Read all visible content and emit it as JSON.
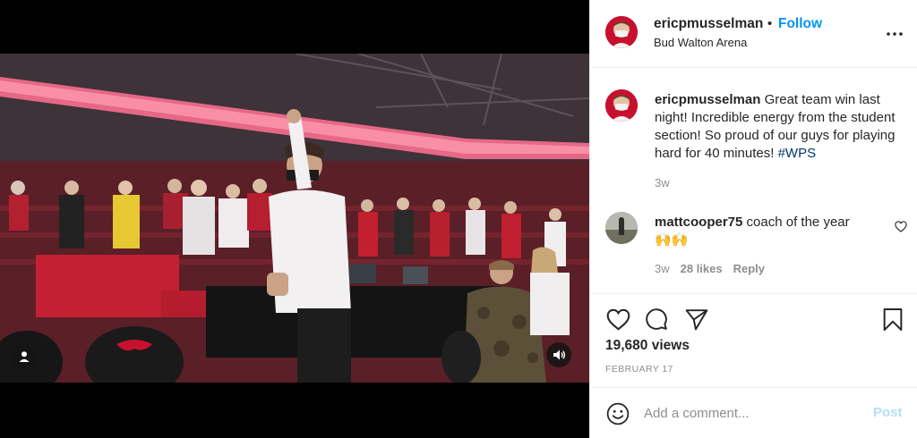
{
  "post": {
    "username": "ericpmusselman",
    "separator": "•",
    "follow_label": "Follow",
    "location": "Bud Walton Arena"
  },
  "caption": {
    "username": "ericpmusselman",
    "text": "Great team win last night! Incredible energy from the student section! So proud of our guys for playing hard for 40 minutes!",
    "hashtag": "#WPS",
    "time": "3w"
  },
  "comment": {
    "username": "mattcooper75",
    "text": "coach of the year",
    "emoji": "🙌🙌",
    "time": "3w",
    "likes": "28 likes",
    "reply_label": "Reply"
  },
  "stats": {
    "views": "19,680 views",
    "date": "FEBRUARY 17"
  },
  "add_comment": {
    "placeholder": "Add a comment...",
    "post_label": "Post"
  },
  "colors": {
    "accent": "#0095f6",
    "post_disabled": "#b2dffc",
    "hashtag": "#00376b",
    "muted": "#8e8e8e",
    "arena_red": "#c8102e"
  },
  "icons": {
    "more": "more-options-icon",
    "like": "heart-icon",
    "comment": "comment-bubble-icon",
    "share": "paper-plane-icon",
    "save": "bookmark-icon",
    "emoji": "smiley-icon",
    "user_tag": "user-tag-icon",
    "sound": "speaker-icon"
  }
}
